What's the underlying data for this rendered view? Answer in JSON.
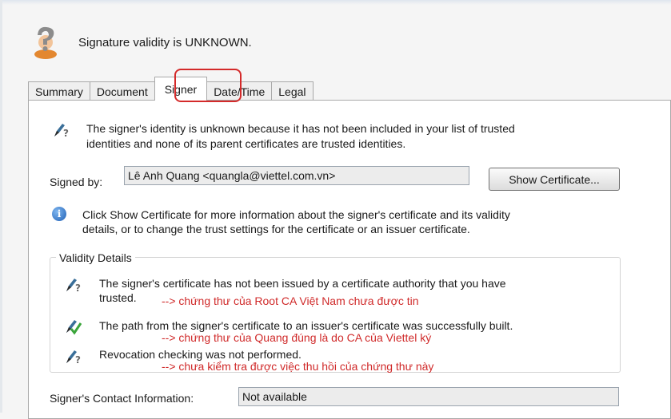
{
  "header": {
    "title": "Signature validity is UNKNOWN.",
    "status_icon": "unknown-signer-icon"
  },
  "tabs": [
    {
      "label": "Summary"
    },
    {
      "label": "Document"
    },
    {
      "label": "Signer",
      "active": true
    },
    {
      "label": "Date/Time"
    },
    {
      "label": "Legal"
    }
  ],
  "signer": {
    "identity_message": "The signer's identity is unknown because it has not been included in your list of trusted",
    "identity_message_2": "identities and none of its parent certificates are trusted identities.",
    "signed_by_label": "Signed by:",
    "signed_by_value": "Lê Anh Quang <quangla@viettel.com.vn>",
    "show_certificate_label": "Show Certificate...",
    "info_message": "Click Show Certificate for more information about the signer's certificate and its validity",
    "info_message_2": "details, or to change the trust settings for the certificate or an issuer certificate."
  },
  "validity": {
    "legend": "Validity Details",
    "items": [
      {
        "icon": "unknown-pen-icon",
        "text": "The signer's certificate has not been issued by a certificate authority that you have",
        "text_2": "trusted.",
        "annotation": "--> chứng thư của Root CA Việt Nam chưa được tin"
      },
      {
        "icon": "valid-pen-icon",
        "text": "The path from the signer's certificate to an issuer's certificate was successfully built.",
        "annotation": "--> chứng thư của Quang đúng là do CA của Viettel ký"
      },
      {
        "icon": "unknown-pen-icon",
        "text": "Revocation checking was not performed.",
        "annotation": "--> chưa kiểm tra được việc thu hồi của chứng thư này"
      }
    ]
  },
  "contact": {
    "label": "Signer's Contact Information:",
    "value": "Not available"
  },
  "colors": {
    "annotation": "#d02a2a",
    "highlight": "#d42a2a"
  }
}
